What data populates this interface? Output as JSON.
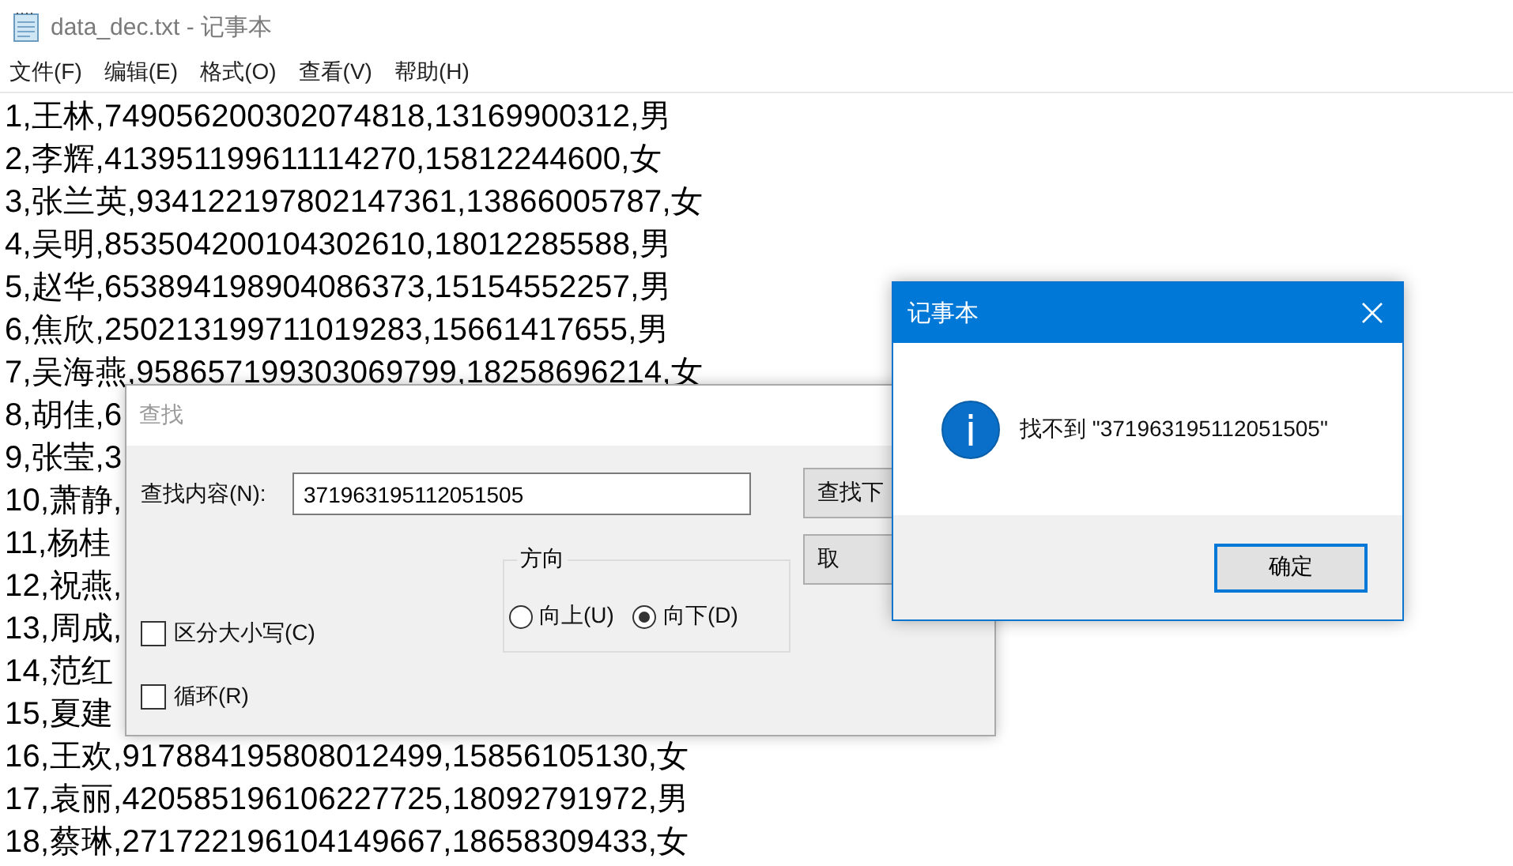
{
  "window": {
    "title": "data_dec.txt - 记事本"
  },
  "menu": [
    {
      "label": "文件(F)"
    },
    {
      "label": "编辑(E)"
    },
    {
      "label": "格式(O)"
    },
    {
      "label": "查看(V)"
    },
    {
      "label": "帮助(H)"
    }
  ],
  "lines": [
    "1,王林,749056200302074818,13169900312,男",
    "2,李辉,413951199611114270,15812244600,女",
    "3,张兰英,934122197802147361,13866005787,女",
    "4,吴明,853504200104302610,18012285588,男",
    "5,赵华,653894198904086373,15154552257,男",
    "6,焦欣,250213199711019283,15661417655,男",
    "7,吴海燕,958657199303069799,18258696214,女",
    "8,胡佳,6",
    "9,张莹,3",
    "10,萧静,",
    "11,杨桂",
    "12,祝燕,",
    "13,周成,",
    "14,范红",
    "15,夏建",
    "16,王欢,917884195808012499,15856105130,女",
    "17,袁丽,420585196106227725,18092791972,男",
    "18,蔡琳,271722196104149667,18658309433,女"
  ],
  "find_dialog": {
    "title": "查找",
    "find_label": "查找内容(N):",
    "find_value": "371963195112051505",
    "options": [
      {
        "label": "区分大小写(C)",
        "checked": false
      },
      {
        "label": "循环(R)",
        "checked": false
      }
    ],
    "direction": {
      "label": "方向",
      "choices": [
        {
          "label": "向上(U)",
          "selected": false
        },
        {
          "label": "向下(D)",
          "selected": true
        }
      ]
    },
    "buttons": [
      "查找下",
      "取"
    ]
  },
  "message_box": {
    "title": "记事本",
    "message": "找不到 \"371963195112051505\"",
    "button": "确定"
  }
}
